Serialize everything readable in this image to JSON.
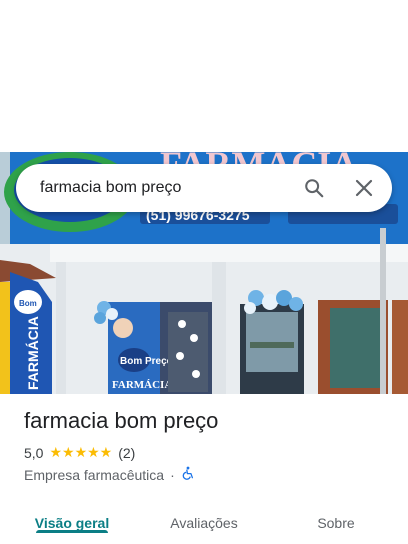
{
  "search": {
    "query": "farmacia bom preço"
  },
  "icons": {
    "search": "search-icon",
    "clear": "close-icon",
    "accessibility": "wheelchair-icon",
    "star": "star-icon"
  },
  "photo": {
    "sign_text": "FARMÁCIA",
    "phone_text": "(51) 99676-3275",
    "banner_text": "FARMÁCIA",
    "poster_logo": "Bom Preço",
    "poster_text": "FARMÁCIA"
  },
  "place": {
    "name": "farmacia bom preço",
    "rating": "5,0",
    "stars": "★★★★★",
    "review_count": "(2)",
    "category": "Empresa farmacêutica",
    "separator": "·"
  },
  "tabs": [
    "Visão geral",
    "Avaliações",
    "Sobre"
  ],
  "colors": {
    "accent": "#0b7e85",
    "star": "#fbbc04",
    "sign_blue": "#1a6fd1"
  }
}
